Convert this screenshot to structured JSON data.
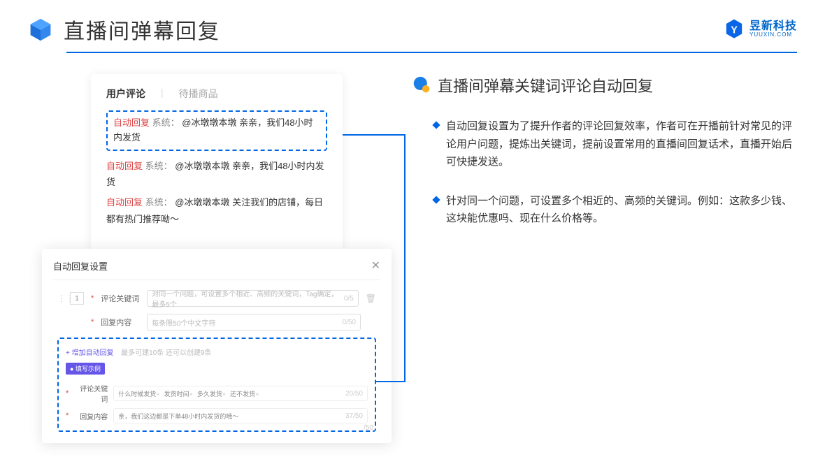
{
  "header": {
    "title": "直播间弹幕回复",
    "brand": "昱新科技",
    "brand_url": "YUUXIN.COM"
  },
  "comment_card": {
    "tab_active": "用户评论",
    "tab_inactive": "待播商品",
    "highlight": {
      "tag": "自动回复",
      "sys": "系统：",
      "msg": "@冰墩墩本墩 亲亲，我们48小时内发货"
    },
    "msg2": {
      "tag": "自动回复",
      "sys": "系统：",
      "text": "@冰墩墩本墩 亲亲，我们48小时内发货"
    },
    "msg3": {
      "tag": "自动回复",
      "sys": "系统：",
      "text": "@冰墩墩本墩 关注我们的店铺，每日都有热门推荐呦～"
    }
  },
  "modal": {
    "title": "自动回复设置",
    "num": "1",
    "label_keyword": "评论关键词",
    "ph_keyword": "对同一个问题，可设置多个相近、高频的关键词，Tag确定，最多5个",
    "count_keyword": "0/5",
    "label_reply": "回复内容",
    "ph_reply": "每条限50个中文字符",
    "count_reply": "0/50",
    "add_link": "+ 增加自动回复",
    "add_hint": "最多可建10条 还可以创建9条",
    "ex_badge": "● 填写示例",
    "ex_label_keyword": "评论关键词",
    "ex_tags": [
      "什么时候发货",
      "发货时间",
      "多久发货",
      "还不发货"
    ],
    "ex_count_keyword": "20/50",
    "ex_label_reply": "回复内容",
    "ex_reply_val": "亲，我们这边都是下单48小时内发货的哦～",
    "ex_count_reply": "37/50",
    "trailing_counter": "/50"
  },
  "right": {
    "section_title": "直播间弹幕关键词评论自动回复",
    "bullet1": "自动回复设置为了提升作者的评论回复效率，作者可在开播前针对常见的评论用户问题，提炼出关键词，提前设置常用的直播间回复话术，直播开始后可快捷发送。",
    "bullet2": "针对同一个问题，可设置多个相近的、高频的关键词。例如：这款多少钱、这块能优惠吗、现在什么价格等。"
  }
}
